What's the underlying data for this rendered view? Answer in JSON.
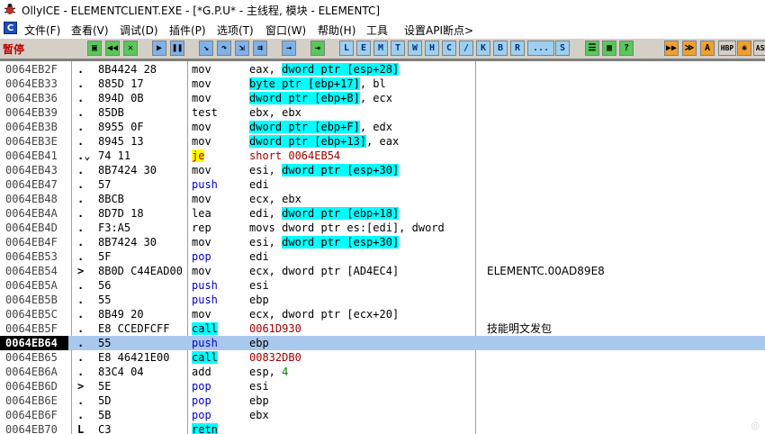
{
  "window": {
    "title": "OllyICE - ELEMENTCLIENT.EXE - [*G.P.U* - 主线程, 模块 - ELEMENTC]"
  },
  "menu": {
    "mdi_letter": "C",
    "items": [
      "文件(F)",
      "查看(V)",
      "调试(D)",
      "插件(P)",
      "选项(T)",
      "窗口(W)",
      "帮助(H)",
      "工具",
      "设置API断点>"
    ]
  },
  "toolbar": {
    "status": "暂停",
    "letter_buttons": [
      "L",
      "E",
      "M",
      "T",
      "W",
      "H",
      "C",
      "/",
      "K",
      "B",
      "R",
      "...",
      "S"
    ],
    "right_labels": [
      "HBP",
      "ASM"
    ]
  },
  "colors": {
    "highlight_cyan": "#00ffff",
    "highlight_yellow": "#ffff00",
    "selection": "#a9c8ee",
    "push_pop": "#0000c8"
  },
  "rows": [
    {
      "addr": "0064EB2F",
      "mark": ".",
      "hex": "8B4424 28",
      "mn": "mov",
      "op_pre": "eax, ",
      "op_hl": "dword ptr [esp+28]",
      "op_post": "",
      "comment": ""
    },
    {
      "addr": "0064EB33",
      "mark": ".",
      "hex": "885D 17",
      "mn": "mov",
      "op_pre": "",
      "op_hl": "byte ptr [ebp+17]",
      "op_post": ", bl",
      "comment": ""
    },
    {
      "addr": "0064EB36",
      "mark": ".",
      "hex": "894D 0B",
      "mn": "mov",
      "op_pre": "",
      "op_hl": "dword ptr [ebp+B]",
      "op_post": ", ecx",
      "comment": ""
    },
    {
      "addr": "0064EB39",
      "mark": ".",
      "hex": "85DB",
      "mn": "test",
      "op_pre": "ebx, ebx",
      "op_hl": "",
      "op_post": "",
      "comment": ""
    },
    {
      "addr": "0064EB3B",
      "mark": ".",
      "hex": "8955 0F",
      "mn": "mov",
      "op_pre": "",
      "op_hl": "dword ptr [ebp+F]",
      "op_post": ", edx",
      "comment": ""
    },
    {
      "addr": "0064EB3E",
      "mark": ".",
      "hex": "8945 13",
      "mn": "mov",
      "op_pre": "",
      "op_hl": "dword ptr [ebp+13]",
      "op_post": ", eax",
      "comment": ""
    },
    {
      "addr": "0064EB41",
      "mark": ".⌄",
      "hex": "74 11",
      "mn": "je",
      "op_pre": "short 0064EB54",
      "op_hl": "",
      "op_post": "",
      "comment": "",
      "kind": "jump"
    },
    {
      "addr": "0064EB43",
      "mark": ".",
      "hex": "8B7424 30",
      "mn": "mov",
      "op_pre": "esi, ",
      "op_hl": "dword ptr [esp+30]",
      "op_post": "",
      "comment": ""
    },
    {
      "addr": "0064EB47",
      "mark": ".",
      "hex": "57",
      "mn": "push",
      "op_pre": "edi",
      "op_hl": "",
      "op_post": "",
      "comment": "",
      "kind": "stack"
    },
    {
      "addr": "0064EB48",
      "mark": ".",
      "hex": "8BCB",
      "mn": "mov",
      "op_pre": "ecx, ebx",
      "op_hl": "",
      "op_post": "",
      "comment": ""
    },
    {
      "addr": "0064EB4A",
      "mark": ".",
      "hex": "8D7D 18",
      "mn": "lea",
      "op_pre": "edi, ",
      "op_hl": "dword ptr [ebp+18]",
      "op_post": "",
      "comment": ""
    },
    {
      "addr": "0064EB4D",
      "mark": ".",
      "hex": "F3:A5",
      "mn": "rep",
      "op_pre": "movs dword ptr es:[edi], dword ",
      "op_hl": "",
      "op_post": "",
      "comment": ""
    },
    {
      "addr": "0064EB4F",
      "mark": ".",
      "hex": "8B7424 30",
      "mn": "mov",
      "op_pre": "esi, ",
      "op_hl": "dword ptr [esp+30]",
      "op_post": "",
      "comment": ""
    },
    {
      "addr": "0064EB53",
      "mark": ".",
      "hex": "5F",
      "mn": "pop",
      "op_pre": "edi",
      "op_hl": "",
      "op_post": "",
      "comment": "",
      "kind": "stack"
    },
    {
      "addr": "0064EB54",
      "mark": ">",
      "hex": "8B0D C44EAD00",
      "mn": "mov",
      "op_pre": "ecx, dword ptr [AD4EC4]",
      "op_hl": "",
      "op_post": "",
      "comment": "ELEMENTC.00AD89E8"
    },
    {
      "addr": "0064EB5A",
      "mark": ".",
      "hex": "56",
      "mn": "push",
      "op_pre": "esi",
      "op_hl": "",
      "op_post": "",
      "comment": "",
      "kind": "stack"
    },
    {
      "addr": "0064EB5B",
      "mark": ".",
      "hex": "55",
      "mn": "push",
      "op_pre": "ebp",
      "op_hl": "",
      "op_post": "",
      "comment": "",
      "kind": "stack"
    },
    {
      "addr": "0064EB5C",
      "mark": ".",
      "hex": "8B49 20",
      "mn": "mov",
      "op_pre": "ecx, dword ptr [ecx+20]",
      "op_hl": "",
      "op_post": "",
      "comment": ""
    },
    {
      "addr": "0064EB5F",
      "mark": ".",
      "hex": "E8 CCEDFCFF",
      "mn": "call",
      "op_pre": "0061D930",
      "op_hl": "",
      "op_post": "",
      "comment": "技能明文发包",
      "kind": "call"
    },
    {
      "addr": "0064EB64",
      "mark": ".",
      "hex": "55",
      "mn": "push",
      "op_pre": "ebp",
      "op_hl": "",
      "op_post": "",
      "comment": "",
      "kind": "stack",
      "selected": true
    },
    {
      "addr": "0064EB65",
      "mark": ".",
      "hex": "E8 46421E00",
      "mn": "call",
      "op_pre": "00832DB0",
      "op_hl": "",
      "op_post": "",
      "comment": "",
      "kind": "call"
    },
    {
      "addr": "0064EB6A",
      "mark": ".",
      "hex": "83C4 04",
      "mn": "add",
      "op_pre": "esp, ",
      "op_hl": "",
      "op_post": "",
      "op_num": "4",
      "comment": ""
    },
    {
      "addr": "0064EB6D",
      "mark": ">",
      "hex": "5E",
      "mn": "pop",
      "op_pre": "esi",
      "op_hl": "",
      "op_post": "",
      "comment": "",
      "kind": "stack"
    },
    {
      "addr": "0064EB6E",
      "mark": ".",
      "hex": "5D",
      "mn": "pop",
      "op_pre": "ebp",
      "op_hl": "",
      "op_post": "",
      "comment": "",
      "kind": "stack"
    },
    {
      "addr": "0064EB6F",
      "mark": ".",
      "hex": "5B",
      "mn": "pop",
      "op_pre": "ebx",
      "op_hl": "",
      "op_post": "",
      "comment": "",
      "kind": "stack"
    },
    {
      "addr": "0064EB70",
      "mark": "L",
      "hex": "C3",
      "mn": "retn",
      "op_pre": "",
      "op_hl": "",
      "op_post": "",
      "comment": "",
      "kind": "call"
    }
  ]
}
